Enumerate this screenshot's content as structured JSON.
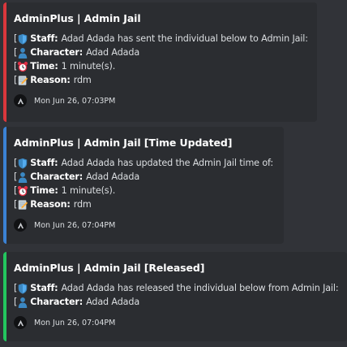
{
  "embeds": [
    {
      "color": "#da373c",
      "title": "AdminPlus | Admin Jail",
      "fields": [
        {
          "bracket": "[",
          "icon": "shield-emoji",
          "label": "Staff:",
          "value": "Adad Adada has sent the individual below to Admin Jail:"
        },
        {
          "bracket": "[",
          "icon": "person-emoji",
          "label": "Character:",
          "value": "Adad Adada"
        },
        {
          "bracket": "[",
          "icon": "alarm-clock-emoji",
          "label": "Time:",
          "value": "1 minute(s)."
        },
        {
          "bracket": "[",
          "icon": "memo-emoji",
          "label": "Reason:",
          "value": "rdm"
        }
      ],
      "footer": "Mon Jun 26, 07:03PM"
    },
    {
      "color": "#3b82d4",
      "title": "AdminPlus | Admin Jail [Time Updated]",
      "fields": [
        {
          "bracket": "[",
          "icon": "shield-emoji",
          "label": "Staff:",
          "value": "Adad Adada has updated the Admin Jail time of:"
        },
        {
          "bracket": "[",
          "icon": "person-emoji",
          "label": "Character:",
          "value": "Adad Adada"
        },
        {
          "bracket": "[",
          "icon": "alarm-clock-emoji",
          "label": "Time:",
          "value": "1 minute(s)."
        },
        {
          "bracket": "[",
          "icon": "memo-emoji",
          "label": "Reason:",
          "value": "rdm"
        }
      ],
      "footer": "Mon Jun 26, 07:04PM"
    },
    {
      "color": "#23c55e",
      "title": "AdminPlus | Admin Jail [Released]",
      "fields": [
        {
          "bracket": "[",
          "icon": "shield-emoji",
          "label": "Staff:",
          "value": "Adad Adada has released the individual below from Admin Jail:"
        },
        {
          "bracket": "[",
          "icon": "person-emoji",
          "label": "Character:",
          "value": "Adad Adada"
        }
      ],
      "footer": "Mon Jun 26, 07:04PM"
    }
  ]
}
